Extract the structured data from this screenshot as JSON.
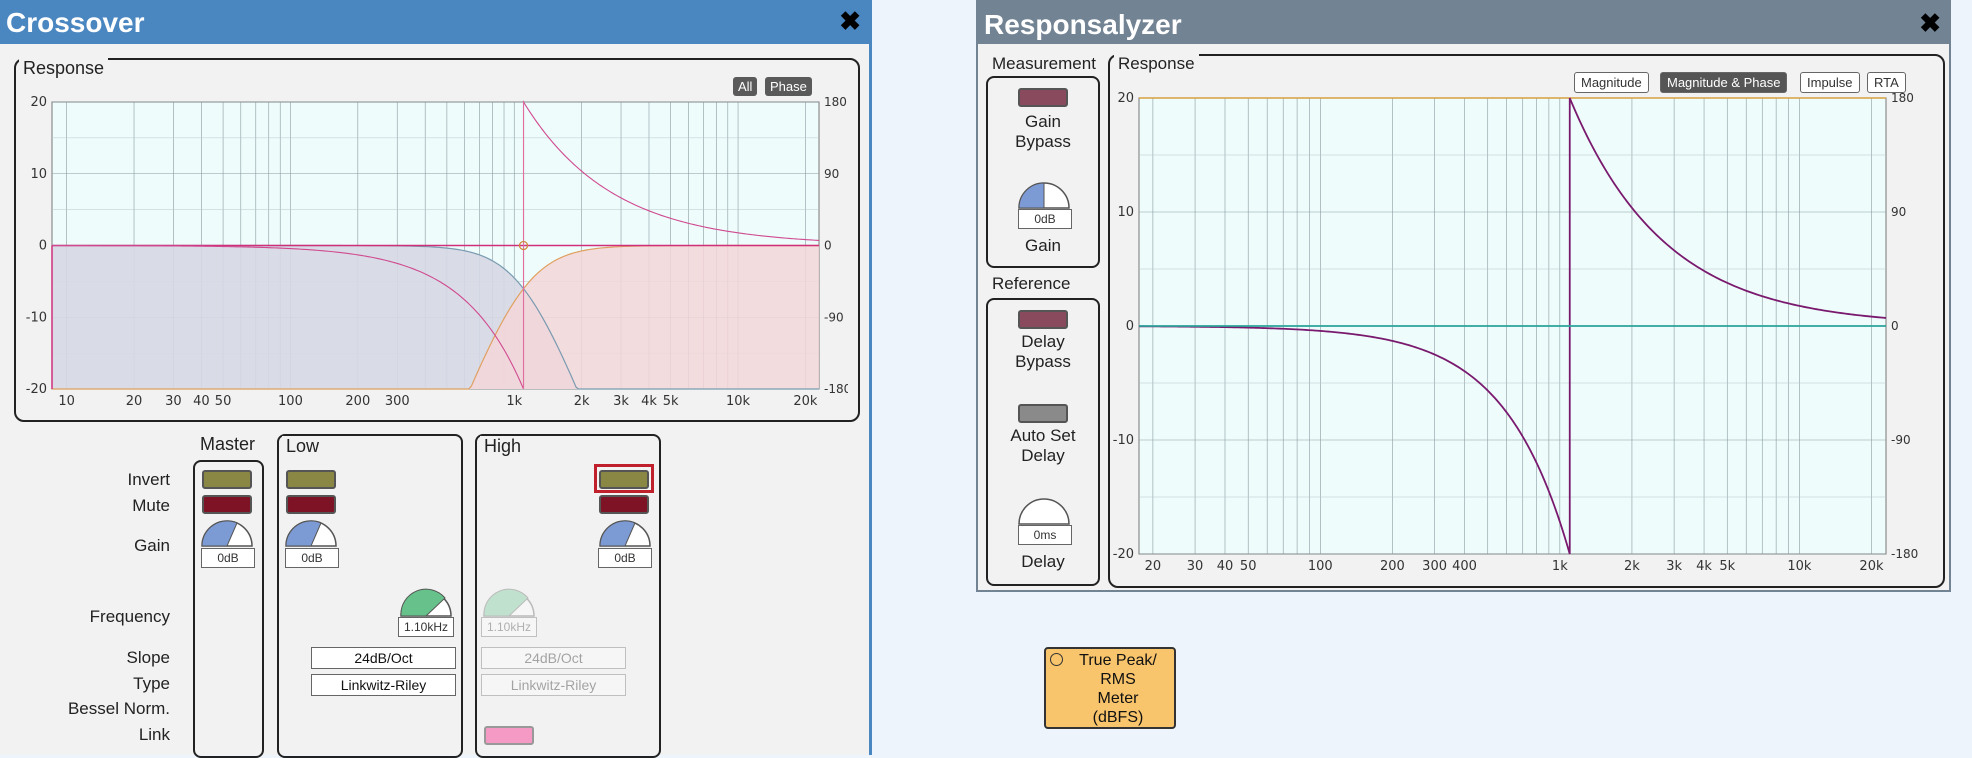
{
  "crossover": {
    "title": "Crossover",
    "close": "✖",
    "response_tab": "Response",
    "btn_all": "All",
    "btn_phase": "Phase",
    "y_left_ticks": [
      "20",
      "10",
      "0",
      "-10",
      "-20"
    ],
    "y_right_ticks": [
      "180",
      "90",
      "0",
      "-90",
      "-180"
    ],
    "x_ticks": [
      "10",
      "20",
      "30",
      "40",
      "50",
      "100",
      "200",
      "300",
      "1k",
      "2k",
      "3k",
      "4k",
      "5k",
      "10k",
      "20k"
    ],
    "row_labels": {
      "invert": "Invert",
      "mute": "Mute",
      "gain": "Gain",
      "frequency": "Frequency",
      "slope": "Slope",
      "type": "Type",
      "bessel": "Bessel Norm.",
      "link": "Link"
    },
    "groups": {
      "master": {
        "label": "Master",
        "gain": "0dB"
      },
      "low": {
        "label": "Low",
        "gain": "0dB",
        "frequency": "1.10kHz",
        "slope": "24dB/Oct",
        "type": "Linkwitz-Riley"
      },
      "high": {
        "label": "High",
        "gain": "0dB",
        "frequency": "1.10kHz",
        "slope": "24dB/Oct",
        "type": "Linkwitz-Riley"
      }
    }
  },
  "responsalyzer": {
    "title": "Responsalyzer",
    "close": "✖",
    "measurement_tab": "Measurement",
    "reference_tab": "Reference",
    "response_tab": "Response",
    "gain_bypass": "Gain\nBypass",
    "gain_value": "0dB",
    "gain_label": "Gain",
    "delay_bypass": "Delay\nBypass",
    "auto_set_delay": "Auto Set\nDelay",
    "delay_value": "0ms",
    "delay_label": "Delay",
    "view_buttons": [
      "Magnitude",
      "Magnitude & Phase",
      "Impulse",
      "RTA"
    ],
    "selected_view": "Magnitude & Phase",
    "y_left_ticks": [
      "20",
      "10",
      "0",
      "-10",
      "-20"
    ],
    "y_right_ticks": [
      "180",
      "90",
      "0",
      "-90",
      "-180"
    ],
    "x_ticks": [
      "20",
      "30",
      "40",
      "50",
      "100",
      "200",
      "300",
      "400",
      "1k",
      "2k",
      "3k",
      "4k",
      "5k",
      "10k",
      "20k"
    ]
  },
  "meter_block": {
    "label": "True Peak/\nRMS\nMeter\n(dBFS)"
  },
  "colors": {
    "crossover_titlebar": "#4a86c0",
    "responsalyzer_titlebar": "#728393",
    "plot_bg": "#eefcfc",
    "low_fill": "#d6d8e4",
    "high_fill": "#f3d6d8",
    "phase_curve": "#7a1a6e",
    "mag_curve": "#2aa39a"
  }
}
